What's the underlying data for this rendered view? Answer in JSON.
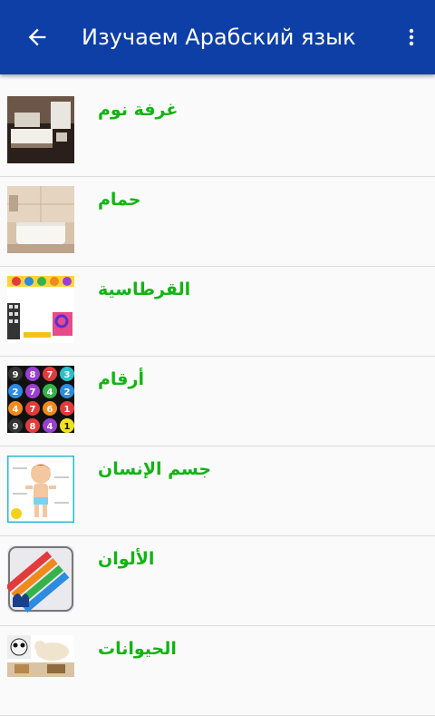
{
  "appbar": {
    "title": "Изучаем Арабский язык",
    "back_icon": "arrow-back-icon",
    "menu_icon": "more-vertical-icon",
    "color": "#0e3fa6"
  },
  "accent_text_color": "#12b412",
  "topics": [
    {
      "label": "غرفة نوم",
      "thumbnail": "bedroom"
    },
    {
      "label": "حمام",
      "thumbnail": "bathroom"
    },
    {
      "label": "القرطاسية",
      "thumbnail": "stationery"
    },
    {
      "label": "أرقام",
      "thumbnail": "numbers"
    },
    {
      "label": "جسم الإنسان",
      "thumbnail": "human-body"
    },
    {
      "label": "الألوان",
      "thumbnail": "colors"
    },
    {
      "label": "الحيوانات",
      "thumbnail": "animals"
    }
  ]
}
